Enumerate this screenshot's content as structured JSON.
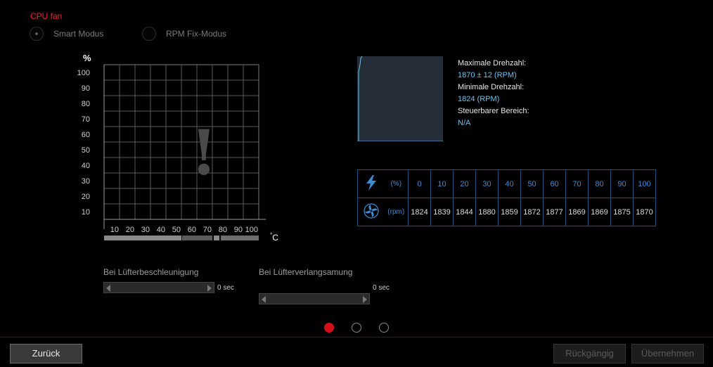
{
  "title": "CPU fan",
  "modes": [
    {
      "label": "Smart Modus",
      "selected": true
    },
    {
      "label": "RPM Fix-Modus",
      "selected": false
    }
  ],
  "chart": {
    "y_unit": "%",
    "x_unit_deg": "°",
    "x_unit_c": "C",
    "y_ticks": [
      "100",
      "90",
      "80",
      "70",
      "60",
      "50",
      "40",
      "30",
      "20",
      "10"
    ],
    "x_ticks": [
      "10",
      "20",
      "30",
      "40",
      "50",
      "60",
      "70",
      "80",
      "90",
      "100"
    ],
    "warning_symbol": "!"
  },
  "info": {
    "max_label": "Maximale Drehzahl:",
    "max_value": "1870 ± 12 (RPM)",
    "min_label": "Minimale Drehzahl:",
    "min_value": "1824 (RPM)",
    "range_label": "Steuerbarer Bereich:",
    "range_value": "N/A"
  },
  "table": {
    "percent_unit": "(%)",
    "rpm_unit": "(rpm)",
    "percent": [
      "0",
      "10",
      "20",
      "30",
      "40",
      "50",
      "60",
      "70",
      "80",
      "90",
      "100"
    ],
    "rpm": [
      "1824",
      "1839",
      "1844",
      "1880",
      "1859",
      "1872",
      "1877",
      "1869",
      "1869",
      "1875",
      "1870"
    ]
  },
  "sliders": {
    "accel_label": "Bei Lüfterbeschleunigung",
    "accel_value": "0 sec",
    "decel_label": "Bei Lüfterverlangsamung",
    "decel_value": "0 sec"
  },
  "pager": {
    "count": 3,
    "active": 0
  },
  "buttons": {
    "back": "Zurück",
    "undo": "Rückgängig",
    "apply": "Übernehmen"
  },
  "colors": {
    "accent": "#d21016",
    "info_value": "#6cc2ef",
    "table_border": "#1f4e86"
  }
}
